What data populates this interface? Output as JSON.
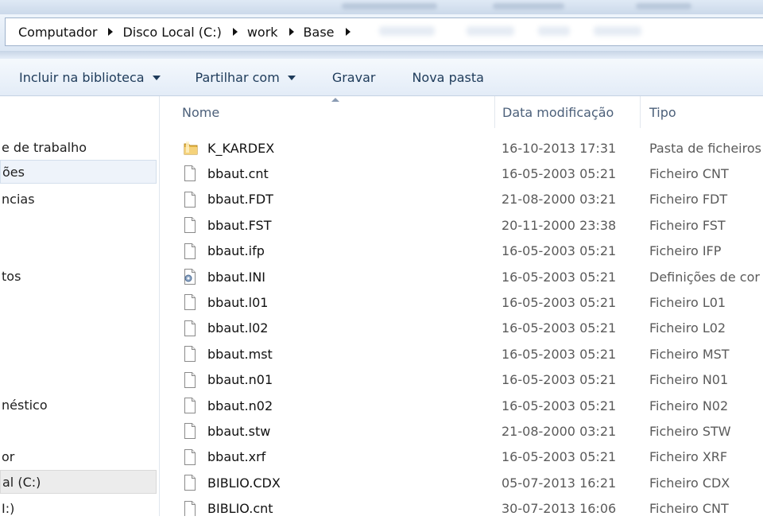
{
  "breadcrumb": [
    "Computador",
    "Disco Local (C:)",
    "work",
    "Base"
  ],
  "toolbar": {
    "include_library": "Incluir na biblioteca",
    "share_with": "Partilhar com",
    "burn": "Gravar",
    "new_folder": "Nova pasta"
  },
  "nav": {
    "items": [
      {
        "label": "e de trabalho"
      },
      {
        "label": "ões"
      },
      {
        "label": "ncias"
      },
      {
        "label": "tos"
      },
      {
        "label": "néstico"
      },
      {
        "label": "or"
      },
      {
        "label": "al (C:)"
      },
      {
        "label": "I:)"
      }
    ]
  },
  "columns": {
    "name": "Nome",
    "date": "Data modificação",
    "type": "Tipo"
  },
  "files": [
    {
      "name": "K_KARDEX",
      "date": "16-10-2013 17:31",
      "type": "Pasta de ficheiros",
      "icon": "folder-icon"
    },
    {
      "name": "bbaut.cnt",
      "date": "16-05-2003 05:21",
      "type": "Ficheiro CNT",
      "icon": "file-icon"
    },
    {
      "name": "bbaut.FDT",
      "date": "21-08-2000 03:21",
      "type": "Ficheiro FDT",
      "icon": "file-icon"
    },
    {
      "name": "bbaut.FST",
      "date": "20-11-2000 23:38",
      "type": "Ficheiro FST",
      "icon": "file-icon"
    },
    {
      "name": "bbaut.ifp",
      "date": "16-05-2003 05:21",
      "type": "Ficheiro IFP",
      "icon": "file-icon"
    },
    {
      "name": "bbaut.INI",
      "date": "16-05-2003 05:21",
      "type": "Definições de cor",
      "icon": "settings-file-icon"
    },
    {
      "name": "bbaut.l01",
      "date": "16-05-2003 05:21",
      "type": "Ficheiro L01",
      "icon": "file-icon"
    },
    {
      "name": "bbaut.l02",
      "date": "16-05-2003 05:21",
      "type": "Ficheiro L02",
      "icon": "file-icon"
    },
    {
      "name": "bbaut.mst",
      "date": "16-05-2003 05:21",
      "type": "Ficheiro MST",
      "icon": "file-icon"
    },
    {
      "name": "bbaut.n01",
      "date": "16-05-2003 05:21",
      "type": "Ficheiro N01",
      "icon": "file-icon"
    },
    {
      "name": "bbaut.n02",
      "date": "16-05-2003 05:21",
      "type": "Ficheiro N02",
      "icon": "file-icon"
    },
    {
      "name": "bbaut.stw",
      "date": "21-08-2000 03:21",
      "type": "Ficheiro STW",
      "icon": "file-icon"
    },
    {
      "name": "bbaut.xrf",
      "date": "16-05-2003 05:21",
      "type": "Ficheiro XRF",
      "icon": "file-icon"
    },
    {
      "name": "BIBLIO.CDX",
      "date": "05-07-2013 16:21",
      "type": "Ficheiro CDX",
      "icon": "file-icon"
    },
    {
      "name": "BIBLIO.cnt",
      "date": "30-07-2013 16:06",
      "type": "Ficheiro CNT",
      "icon": "file-icon"
    }
  ]
}
